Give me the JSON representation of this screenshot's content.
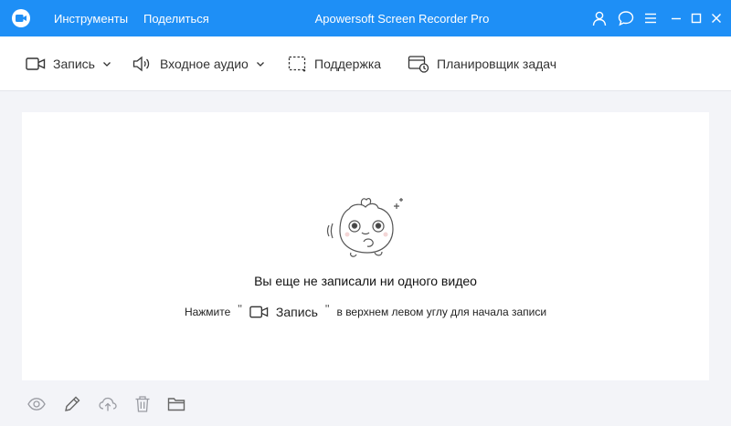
{
  "titlebar": {
    "title": "Apowersoft Screen Recorder Pro",
    "menu": {
      "tools": "Инструменты",
      "share": "Поделиться"
    },
    "accent_color": "#1e8ff6",
    "icons": [
      "user-icon",
      "chat-icon",
      "menu-icon",
      "minimize-icon",
      "maximize-icon",
      "close-icon"
    ]
  },
  "toolbar": {
    "record_label": "Запись",
    "audio_label": "Входное аудио",
    "support_label": "Поддержка",
    "scheduler_label": "Планировщик задач"
  },
  "empty_state": {
    "title": "Вы еще не записали ни одного видео",
    "hint_before": "Нажмите",
    "hint_quote_open": "\"",
    "hint_record_label": "Запись",
    "hint_quote_close": "\"",
    "hint_after": "в верхнем левом углу для начала записи"
  },
  "bottom_bar": {
    "icons": [
      "eye-icon",
      "pencil-icon",
      "upload-icon",
      "trash-icon",
      "folder-icon"
    ]
  }
}
